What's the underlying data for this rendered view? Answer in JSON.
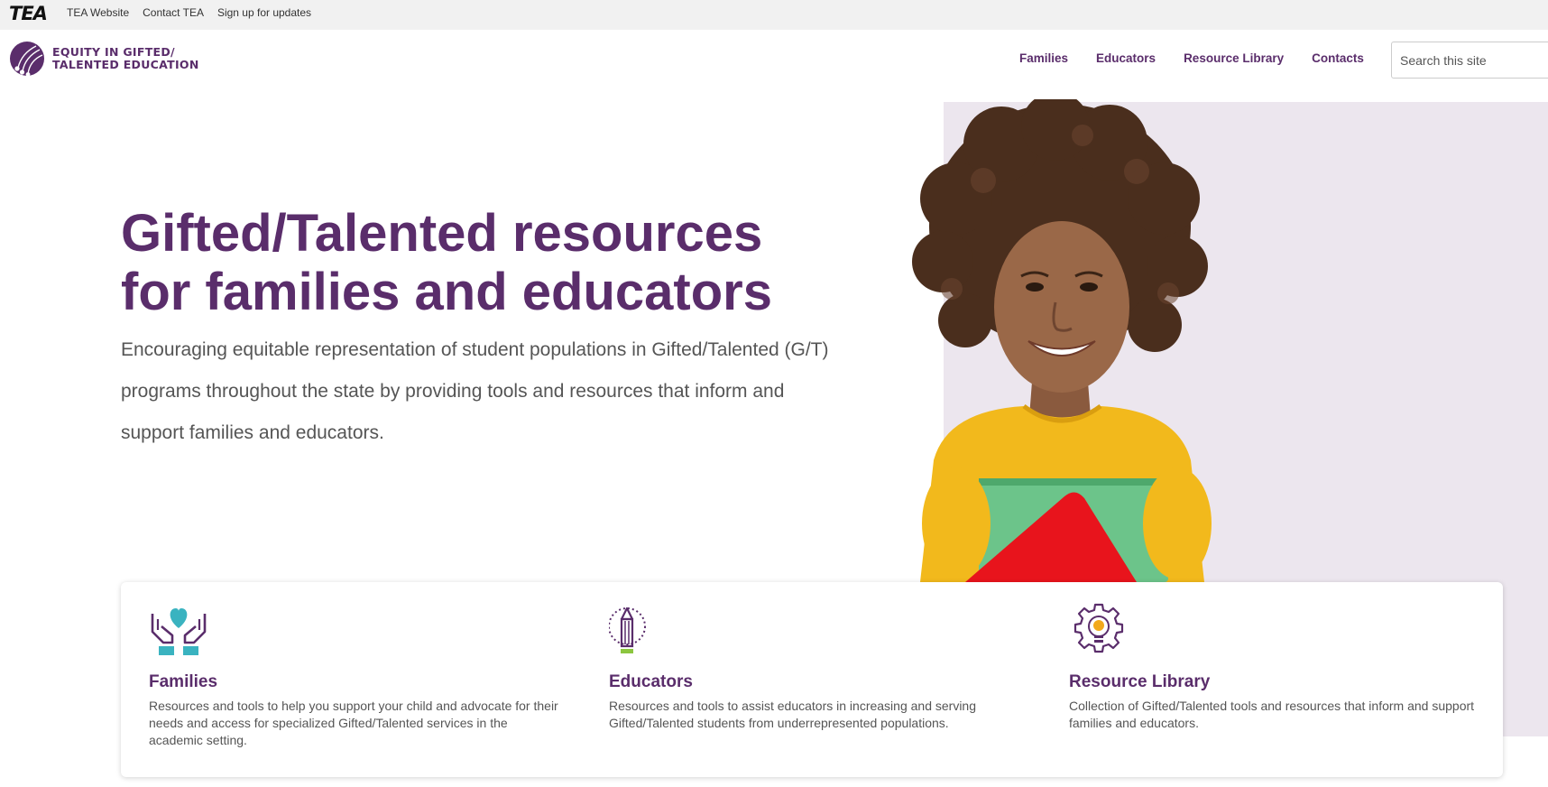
{
  "utility": {
    "logo": "TEA",
    "links": [
      "TEA Website",
      "Contact TEA",
      "Sign up for updates"
    ]
  },
  "brand": {
    "line1": "EQUITY IN GIFTED/",
    "line2": "TALENTED EDUCATION"
  },
  "nav": {
    "items": [
      "Families",
      "Educators",
      "Resource Library",
      "Contacts"
    ]
  },
  "search": {
    "placeholder": "Search this site"
  },
  "hero": {
    "title_line1": "Gifted/Talented resources",
    "title_line2": "for families and educators",
    "subtitle": "Encouraging equitable representation of student populations in Gifted/Talented (G/T) programs throughout the state by providing tools and resources that inform and support families and educators."
  },
  "cards": [
    {
      "icon": "hands-heart-icon",
      "title": "Families",
      "description": "Resources and tools to help you support your child and advocate for their needs and access for specialized Gifted/Talented services in the academic setting."
    },
    {
      "icon": "pencil-icon",
      "title": "Educators",
      "description": "Resources and tools to assist educators in increasing and serving Gifted/Talented students from underrepresented populations."
    },
    {
      "icon": "gear-lightbulb-icon",
      "title": "Resource Library",
      "description": "Collection of Gifted/Talented tools and resources that inform and support families and educators."
    }
  ],
  "colors": {
    "brand_purple": "#5a2d6b",
    "teal": "#3ab3c0",
    "hero_background": "#ece6ee",
    "shirt_yellow": "#f2b91c",
    "book_green": "#6cc48a",
    "book_red": "#e8141c"
  }
}
